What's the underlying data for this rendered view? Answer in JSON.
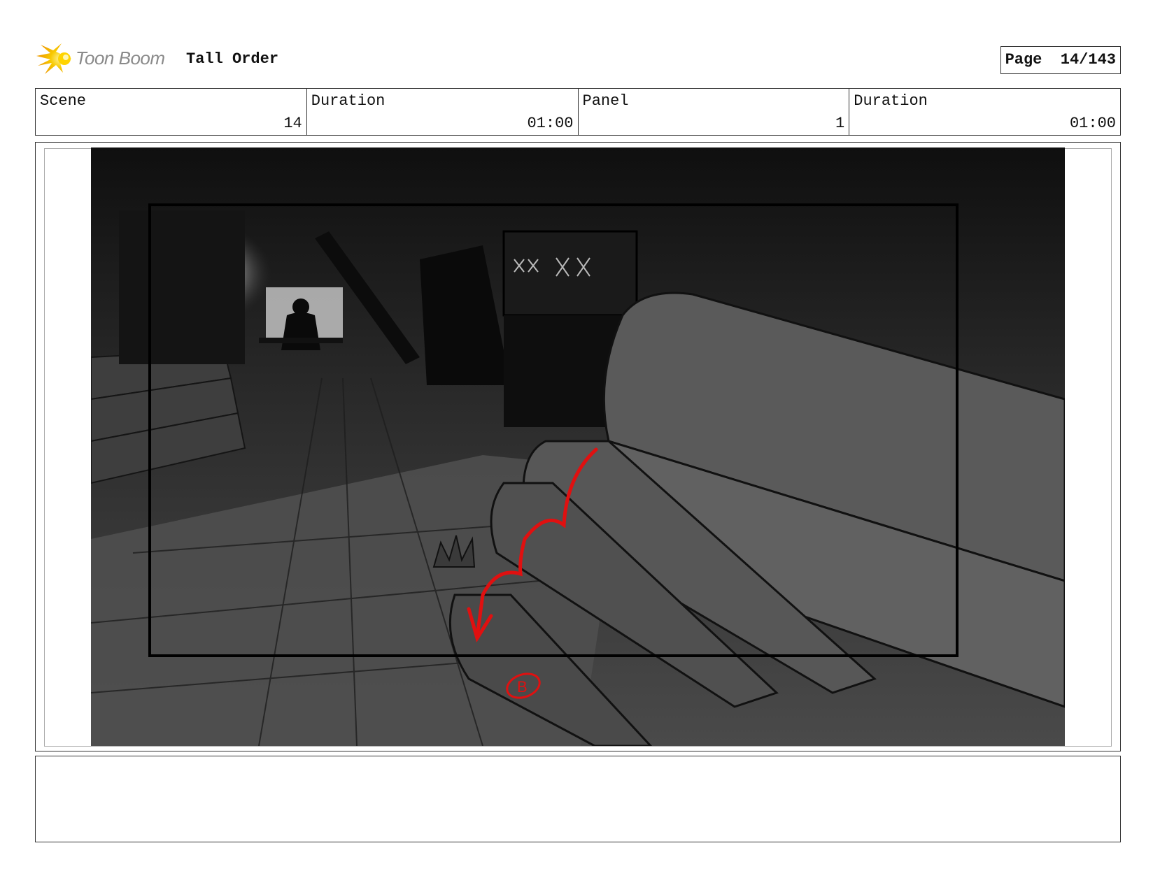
{
  "header": {
    "brand": "Toon Boom",
    "project_title": "Tall Order",
    "page_label": "Page",
    "page_value": "14/143"
  },
  "info": {
    "scene_label": "Scene",
    "scene_value": "14",
    "scene_duration_label": "Duration",
    "scene_duration_value": "01:00",
    "panel_label": "Panel",
    "panel_value": "1",
    "panel_duration_label": "Duration",
    "panel_duration_value": "01:00"
  },
  "panel_art": {
    "annotation_mark": "B",
    "accent_color": "#e01010"
  },
  "colors": {
    "logo_yellow": "#f5c400",
    "border": "#333333"
  }
}
